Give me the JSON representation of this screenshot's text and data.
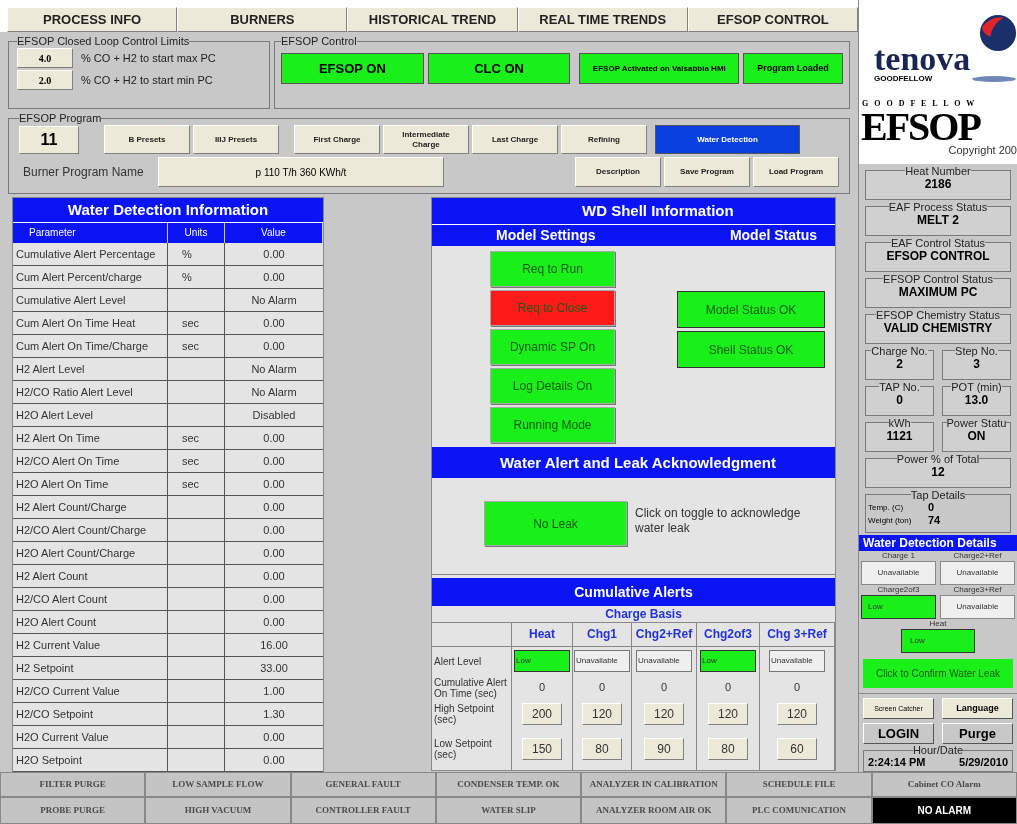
{
  "nav_tabs": [
    {
      "label": "PROCESS INFO"
    },
    {
      "label": "BURNERS"
    },
    {
      "label": "HISTORICAL TREND"
    },
    {
      "label": "REAL TIME TRENDS"
    },
    {
      "label": "EFSOP CONTROL"
    }
  ],
  "closed_loop_limits": {
    "title": "EFSOP Closed Loop Control Limits",
    "rows": [
      {
        "value": "4.0",
        "label": "% CO + H2 to start max PC"
      },
      {
        "value": "2.0",
        "label": "% CO + H2 to start min PC"
      }
    ]
  },
  "efsop_control": {
    "title": "EFSOP Control",
    "indicators": [
      {
        "label": "EFSOP ON",
        "on": true,
        "kind": "large"
      },
      {
        "label": "CLC ON",
        "on": true,
        "kind": "large"
      },
      {
        "label": "EFSOP Activated on Valsabbia HMI",
        "on": true,
        "kind": "small"
      },
      {
        "label": "Program Loaded",
        "on": true,
        "kind": "small"
      }
    ]
  },
  "program": {
    "title": "EFSOP Program",
    "number": "11",
    "buttons": [
      {
        "label": "B Presets",
        "selected": false
      },
      {
        "label": "IIIJ Presets",
        "selected": false
      },
      {
        "label": "First Charge",
        "selected": false
      },
      {
        "label": "Intermediate Charge",
        "selected": false
      },
      {
        "label": "Last Charge",
        "selected": false
      },
      {
        "label": "Refining",
        "selected": false
      },
      {
        "label": "Water Detection",
        "selected": true
      }
    ],
    "name_label": "Burner Program Name",
    "name_value": "p 110 T/h 360 KWh/t",
    "actions": [
      "Description",
      "Save Program",
      "Load Program"
    ]
  },
  "water_detection_info": {
    "title": "Water Detection Information",
    "columns": [
      "Parameter",
      "Units",
      "Value"
    ],
    "rows": [
      {
        "parameter": "Cumulative Alert Percentage",
        "units": "%",
        "value": "0.00"
      },
      {
        "parameter": "Cum Alert Percent/charge",
        "units": "%",
        "value": "0.00"
      },
      {
        "parameter": "Cumulative Alert Level",
        "value": "No  Alarm"
      },
      {
        "parameter": "Cum Alert On Time Heat",
        "units": "sec",
        "value": "0.00"
      },
      {
        "parameter": "Cum Alert On Time/Charge",
        "units": "sec",
        "value": "0.00"
      },
      {
        "parameter": "H2 Alert Level",
        "value": "No Alarm"
      },
      {
        "parameter": "H2/CO Ratio Alert Level",
        "value": "No Alarm"
      },
      {
        "parameter": "H2O Alert Level",
        "value": "Disabled"
      },
      {
        "parameter": "H2 Alert On Time",
        "units": "sec",
        "value": "0.00"
      },
      {
        "parameter": "H2/CO Alert On Time",
        "units": "sec",
        "value": "0.00"
      },
      {
        "parameter": "H2O Alert On Time",
        "units": "sec",
        "value": "0.00"
      },
      {
        "parameter": "H2 Alert Count/Charge",
        "value": "0.00"
      },
      {
        "parameter": "H2/CO Alert Count/Charge",
        "value": "0.00"
      },
      {
        "parameter": "H2O Alert Count/Charge",
        "value": "0.00"
      },
      {
        "parameter": "H2 Alert Count",
        "value": "0.00"
      },
      {
        "parameter": "H2/CO Alert Count",
        "value": "0.00"
      },
      {
        "parameter": "H2O Alert Count",
        "value": "0.00"
      },
      {
        "parameter": "H2 Current Value",
        "value": "16.00"
      },
      {
        "parameter": "H2 Setpoint",
        "value": "33.00"
      },
      {
        "parameter": "H2/CO Current Value",
        "value": "1.00"
      },
      {
        "parameter": "H2/CO Setpoint",
        "value": "1.30"
      },
      {
        "parameter": "H2O Current Value",
        "value": "0.00"
      },
      {
        "parameter": "H2O Setpoint",
        "value": "0.00"
      }
    ]
  },
  "wd_shell": {
    "title": "WD Shell Information",
    "settings_title": "Model Settings",
    "status_title": "Model Status",
    "settings": [
      {
        "label": "Req to Run",
        "on": true
      },
      {
        "label": "Req to Close",
        "on": false
      },
      {
        "label": "Dynamic SP On",
        "on": true
      },
      {
        "label": "Log Details On",
        "on": true
      },
      {
        "label": "Running Mode",
        "on": true
      }
    ],
    "statuses": [
      {
        "label": "Model Status OK",
        "on": true
      },
      {
        "label": "Shell Status OK",
        "on": true
      }
    ],
    "ack_title": "Water Alert and Leak Acknowledgment",
    "leak_button": {
      "label": "No Leak",
      "on": true
    },
    "ack_hint": "Click on toggle to acknowledge water leak",
    "cumulative": {
      "title": "Cumulative Alerts",
      "subtitle": "Charge Basis",
      "columns": [
        "Heat",
        "Chg1",
        "Chg2+Ref",
        "Chg2of3",
        "Chg 3+Ref"
      ],
      "rows": [
        {
          "label": "Alert Level",
          "kind": "level",
          "cells": [
            {
              "text": "Low",
              "lit": true
            },
            {
              "text": "Unavailable",
              "lit": false
            },
            {
              "text": "Unavailable",
              "lit": false
            },
            {
              "text": "Low",
              "lit": true
            },
            {
              "text": "Unavailable",
              "lit": false
            }
          ]
        },
        {
          "label": "Cumulative Alert On Time (sec)",
          "kind": "value",
          "cells": [
            {
              "text": "0"
            },
            {
              "text": "0"
            },
            {
              "text": "0"
            },
            {
              "text": "0"
            },
            {
              "text": "0"
            }
          ]
        },
        {
          "label": "High Setpoint (sec)",
          "kind": "setpoint",
          "cells": [
            {
              "text": "200"
            },
            {
              "text": "120"
            },
            {
              "text": "120"
            },
            {
              "text": "120"
            },
            {
              "text": "120"
            }
          ]
        },
        {
          "label": "Low Setpoint (sec)",
          "kind": "setpoint",
          "cells": [
            {
              "text": "150"
            },
            {
              "text": "80"
            },
            {
              "text": "90"
            },
            {
              "text": "80"
            },
            {
              "text": "60"
            }
          ]
        }
      ]
    }
  },
  "side_panel": {
    "logo": {
      "brand": "tenova",
      "sub": "GOODFELLOW",
      "mark_top": "G O O D F E L L O W",
      "mark": "EFSOP",
      "copyright": "Copyright 200"
    },
    "status_rows": [
      [
        {
          "label": "Heat Number",
          "value": "2186"
        }
      ],
      [
        {
          "label": "EAF Process Status",
          "value": "MELT 2"
        }
      ],
      [
        {
          "label": "EAF Control Status",
          "value": "EFSOP CONTROL"
        }
      ],
      [
        {
          "label": "EFSOP Control Status",
          "value": "MAXIMUM PC"
        }
      ],
      [
        {
          "label": "EFSOP Chemistry Status",
          "value": "VALID CHEMISTRY"
        }
      ],
      [
        {
          "label": "Charge No.",
          "value": "2"
        },
        {
          "label": "Step No.",
          "value": "3"
        }
      ],
      [
        {
          "label": "TAP No.",
          "value": "0"
        },
        {
          "label": "POT (min)",
          "value": "13.0"
        }
      ],
      [
        {
          "label": "kWh",
          "value": "1121"
        },
        {
          "label": "Power Statu",
          "value": "ON"
        }
      ],
      [
        {
          "label": "Power % of Total",
          "value": "12"
        }
      ]
    ],
    "tap_details": {
      "title": "Tap Details",
      "rows": [
        {
          "label": "Temp. (C)",
          "value": "0"
        },
        {
          "label": "Weight (ton)",
          "value": "74"
        }
      ]
    },
    "water_details": {
      "title": "Water Detection Details",
      "items": [
        {
          "label": "Charge 1",
          "value": "Unavailable",
          "lit": false
        },
        {
          "label": "Charge2+Ref",
          "value": "Unavailable",
          "lit": false
        },
        {
          "label": "Charge2of3",
          "value": "Low",
          "lit": true
        },
        {
          "label": "Charge3+Ref",
          "value": "Unavailable",
          "lit": false
        },
        {
          "label": "Heat",
          "value": "Low",
          "lit": true
        }
      ],
      "confirm_button": "Click to Confirm Water Leak"
    },
    "buttons": [
      {
        "label": "Screen Catcher",
        "kind": "small"
      },
      {
        "label": "Language",
        "kind": "bold"
      },
      {
        "label": "LOGIN",
        "kind": "large"
      },
      {
        "label": "Purge",
        "kind": "large"
      }
    ],
    "clock": {
      "title": "Hour/Date",
      "time": "2:24:14 PM",
      "date": "5/29/2010"
    }
  },
  "status_bar": [
    [
      {
        "label": "FILTER PURGE",
        "active": false
      },
      {
        "label": "LOW SAMPLE FLOW",
        "active": false
      },
      {
        "label": "GENERAL FAULT",
        "active": false
      },
      {
        "label": "CONDENSER TEMP. OK",
        "active": false
      },
      {
        "label": "ANALYZER IN CALIBRATION",
        "active": false
      },
      {
        "label": "SCHEDULE FILE",
        "active": false
      },
      {
        "label": "Cabinet CO Alarm",
        "active": false
      }
    ],
    [
      {
        "label": "PROBE PURGE",
        "active": false
      },
      {
        "label": "HIGH VACUUM",
        "active": false
      },
      {
        "label": "CONTROLLER FAULT",
        "active": false
      },
      {
        "label": "WATER SLIP",
        "active": false
      },
      {
        "label": "ANALYZER ROOM AIR OK",
        "active": false
      },
      {
        "label": "PLC COMUNICATION",
        "active": false
      },
      {
        "label": "NO ALARM",
        "active": true
      }
    ]
  ]
}
